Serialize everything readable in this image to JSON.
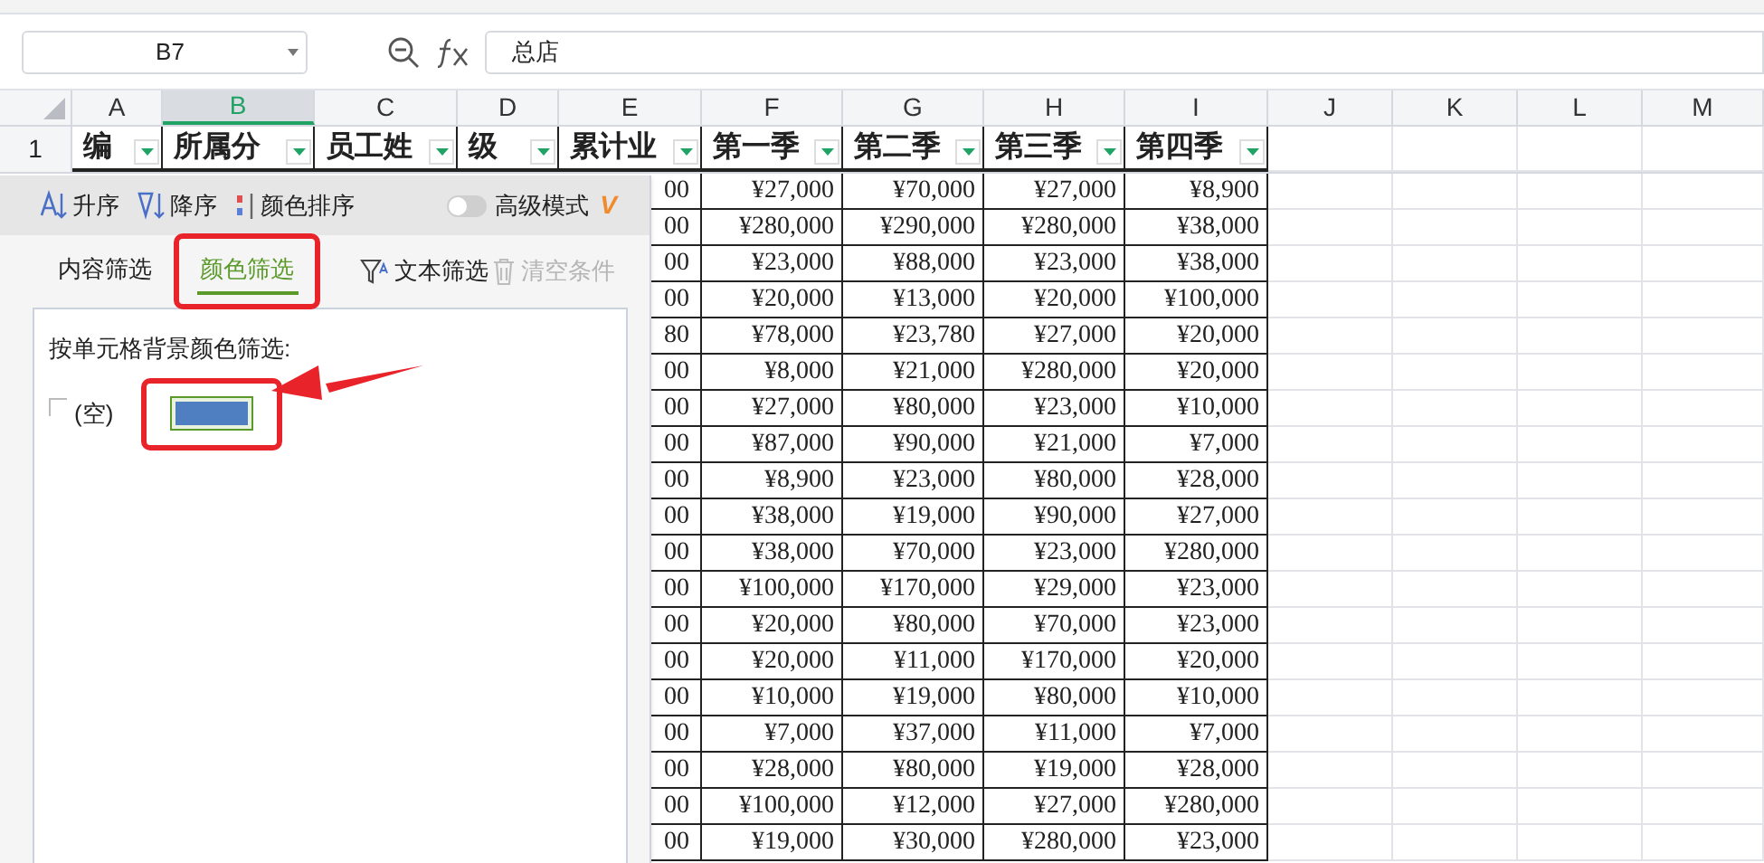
{
  "name_box": {
    "value": "B7"
  },
  "formula_bar": {
    "value": "总店"
  },
  "columns": [
    {
      "label": "A",
      "selected": false
    },
    {
      "label": "B",
      "selected": true
    },
    {
      "label": "C",
      "selected": false
    },
    {
      "label": "D",
      "selected": false
    },
    {
      "label": "E",
      "selected": false
    },
    {
      "label": "F",
      "selected": false
    },
    {
      "label": "G",
      "selected": false
    },
    {
      "label": "H",
      "selected": false
    },
    {
      "label": "I",
      "selected": false
    },
    {
      "label": "J",
      "selected": false
    },
    {
      "label": "K",
      "selected": false
    },
    {
      "label": "L",
      "selected": false
    },
    {
      "label": "M",
      "selected": false
    }
  ],
  "header_row": {
    "row_number": "1",
    "cells": [
      "编",
      "所属分",
      "员工姓",
      "级",
      "累计业",
      "第一季",
      "第二季",
      "第三季",
      "第四季"
    ]
  },
  "rows": [
    {
      "e": "00",
      "values": [
        "¥27,000",
        "¥70,000",
        "¥27,000",
        "¥8,900"
      ]
    },
    {
      "e": "00",
      "values": [
        "¥280,000",
        "¥290,000",
        "¥280,000",
        "¥38,000"
      ]
    },
    {
      "e": "00",
      "values": [
        "¥23,000",
        "¥88,000",
        "¥23,000",
        "¥38,000"
      ]
    },
    {
      "e": "00",
      "values": [
        "¥20,000",
        "¥13,000",
        "¥20,000",
        "¥100,000"
      ]
    },
    {
      "e": "80",
      "values": [
        "¥78,000",
        "¥23,780",
        "¥27,000",
        "¥20,000"
      ]
    },
    {
      "e": "00",
      "values": [
        "¥8,000",
        "¥21,000",
        "¥280,000",
        "¥20,000"
      ]
    },
    {
      "e": "00",
      "values": [
        "¥27,000",
        "¥80,000",
        "¥23,000",
        "¥10,000"
      ]
    },
    {
      "e": "00",
      "values": [
        "¥87,000",
        "¥90,000",
        "¥21,000",
        "¥7,000"
      ]
    },
    {
      "e": "00",
      "values": [
        "¥8,900",
        "¥23,000",
        "¥80,000",
        "¥28,000"
      ]
    },
    {
      "e": "00",
      "values": [
        "¥38,000",
        "¥19,000",
        "¥90,000",
        "¥27,000"
      ]
    },
    {
      "e": "00",
      "values": [
        "¥38,000",
        "¥70,000",
        "¥23,000",
        "¥280,000"
      ]
    },
    {
      "e": "00",
      "values": [
        "¥100,000",
        "¥170,000",
        "¥29,000",
        "¥23,000"
      ]
    },
    {
      "e": "00",
      "values": [
        "¥20,000",
        "¥80,000",
        "¥70,000",
        "¥23,000"
      ]
    },
    {
      "e": "00",
      "values": [
        "¥20,000",
        "¥11,000",
        "¥170,000",
        "¥20,000"
      ]
    },
    {
      "e": "00",
      "values": [
        "¥10,000",
        "¥19,000",
        "¥80,000",
        "¥10,000"
      ]
    },
    {
      "e": "00",
      "values": [
        "¥7,000",
        "¥37,000",
        "¥11,000",
        "¥7,000"
      ]
    },
    {
      "e": "00",
      "values": [
        "¥28,000",
        "¥80,000",
        "¥19,000",
        "¥28,000"
      ]
    },
    {
      "e": "00",
      "values": [
        "¥100,000",
        "¥12,000",
        "¥27,000",
        "¥280,000"
      ]
    },
    {
      "e": "00",
      "values": [
        "¥19,000",
        "¥30,000",
        "¥280,000",
        "¥23,000"
      ]
    }
  ],
  "filter_panel": {
    "sort": [
      {
        "kind": "ascending",
        "label": "升序"
      },
      {
        "kind": "descending",
        "label": "降序"
      },
      {
        "kind": "color",
        "label": "颜色排序"
      }
    ],
    "advanced_mode": {
      "label": "高级模式",
      "on": false,
      "badge": "V"
    },
    "tabs": [
      {
        "label": "内容筛选",
        "selected": false
      },
      {
        "label": "颜色筛选",
        "selected": true
      }
    ],
    "actions": [
      {
        "kind": "text",
        "label": "文本筛选",
        "disabled": false
      },
      {
        "kind": "clear",
        "label": "清空条件",
        "disabled": true
      }
    ],
    "section_label": "按单元格背景颜色筛选:",
    "options": [
      {
        "label": "(空)",
        "checked": false
      }
    ],
    "colors": [
      {
        "color": "#4f7fc1",
        "selected": true
      }
    ]
  }
}
